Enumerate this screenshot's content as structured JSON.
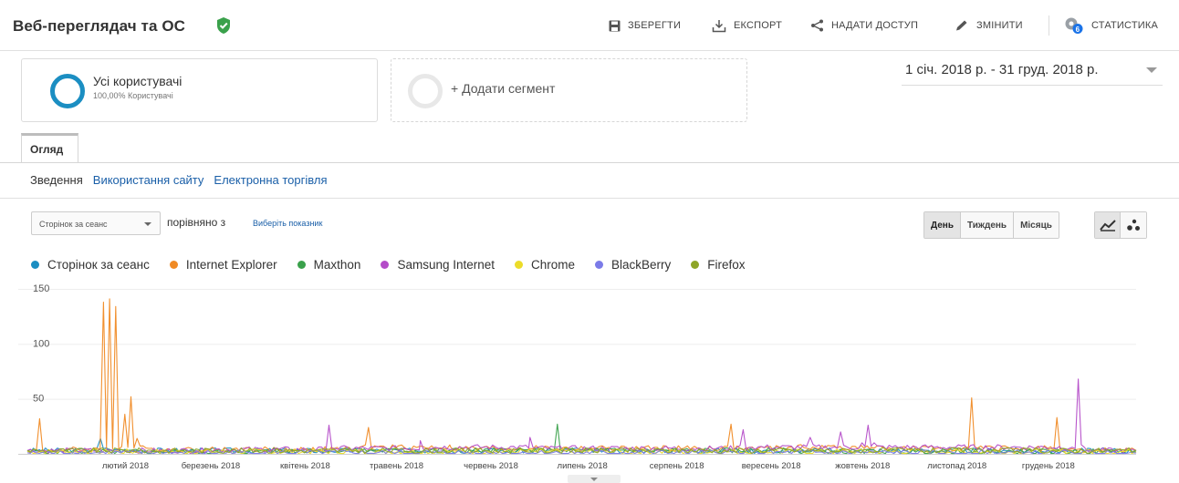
{
  "header": {
    "title": "Веб-переглядач та ОС",
    "actions": {
      "save": "ЗБЕРЕГТИ",
      "export": "ЕКСПОРТ",
      "share": "НАДАТИ ДОСТУП",
      "edit": "ЗМІНИТИ",
      "insights": "СТАТИСТИКА"
    },
    "insights_badge": "6"
  },
  "segments": {
    "active": {
      "name": "Усі користувачі",
      "percent": "100,00% Користувачі"
    },
    "add_label": "+ Додати сегмент"
  },
  "date_range": "1 січ. 2018 р. - 31 груд. 2018 р.",
  "tabs": {
    "overview": "Огляд"
  },
  "subtabs": {
    "summary": "Зведення",
    "site_usage": "Використання сайту",
    "ecommerce": "Електронна торгівля"
  },
  "controls": {
    "metric": "Сторінок за сеанс",
    "compare": "порівняно з",
    "choose_metric": "Виберіть показник",
    "periods": [
      "День",
      "Тиждень",
      "Місяць"
    ],
    "active_period": "День"
  },
  "colors": {
    "accent": "#1b8ec2",
    "verified": "#3aa14b",
    "link": "#1a5fa8"
  },
  "chart_data": {
    "type": "line",
    "title": "",
    "xlabel": "",
    "ylabel": "",
    "ylim": [
      0,
      150
    ],
    "yticks": [
      50,
      100,
      150
    ],
    "grid": true,
    "legend_position": "top-left",
    "xtick_labels": [
      "лютий 2018",
      "березень 2018",
      "квітень 2018",
      "травень 2018",
      "червень 2018",
      "липень 2018",
      "серпень 2018",
      "вересень 2018",
      "жовтень 2018",
      "листопад 2018",
      "грудень 2018"
    ],
    "series": [
      {
        "name": "Сторінок за сеанс",
        "color": "#1b8ec2",
        "x": [
          "2018-01-01",
          "2018-01-20",
          "2018-01-25",
          "2018-01-30",
          "2018-02-15",
          "2018-04-01",
          "2018-06-01",
          "2018-08-01",
          "2018-10-01",
          "2018-12-31"
        ],
        "values": [
          3,
          4,
          14,
          4,
          3,
          3,
          3,
          3,
          3,
          3
        ]
      },
      {
        "name": "Internet Explorer",
        "color": "#f08a24",
        "x": [
          "2018-01-01",
          "2018-01-05",
          "2018-01-09",
          "2018-01-15",
          "2018-01-26",
          "2018-01-28",
          "2018-01-30",
          "2018-02-02",
          "2018-02-04",
          "2018-02-06",
          "2018-02-10",
          "2018-03-15",
          "2018-04-20",
          "2018-04-23",
          "2018-05-20",
          "2018-06-15",
          "2018-07-10",
          "2018-08-07",
          "2018-08-20",
          "2018-08-23",
          "2018-09-05",
          "2018-10-05",
          "2018-11-04",
          "2018-11-07",
          "2018-11-20",
          "2018-12-02",
          "2018-12-05",
          "2018-12-31"
        ],
        "values": [
          3,
          32,
          3,
          4,
          138,
          141,
          134,
          36,
          52,
          14,
          5,
          4,
          6,
          24,
          6,
          5,
          5,
          5,
          27,
          5,
          6,
          6,
          5,
          51,
          5,
          5,
          33,
          3
        ]
      },
      {
        "name": "Maxthon",
        "color": "#3aa14b",
        "x": [
          "2018-01-01",
          "2018-03-15",
          "2018-06-22",
          "2018-06-24",
          "2018-06-26",
          "2018-09-10",
          "2018-12-31"
        ],
        "values": [
          2,
          3,
          4,
          27,
          4,
          3,
          2
        ]
      },
      {
        "name": "Samsung Internet",
        "color": "#b44cc8",
        "x": [
          "2018-01-01",
          "2018-03-01",
          "2018-04-08",
          "2018-04-10",
          "2018-04-12",
          "2018-05-10",
          "2018-06-15",
          "2018-08-10",
          "2018-08-22",
          "2018-08-24",
          "2018-08-26",
          "2018-09-15",
          "2018-09-25",
          "2018-10-02",
          "2018-10-04",
          "2018-10-06",
          "2018-11-20",
          "2018-12-10",
          "2018-12-12",
          "2018-12-14",
          "2018-12-31"
        ],
        "values": [
          3,
          4,
          5,
          26,
          5,
          12,
          15,
          5,
          6,
          22,
          6,
          15,
          20,
          10,
          26,
          10,
          6,
          6,
          68,
          6,
          3
        ]
      },
      {
        "name": "Chrome",
        "color": "#ecdc29",
        "x": [
          "2018-01-01",
          "2018-06-01",
          "2018-12-31"
        ],
        "values": [
          2,
          2,
          2
        ]
      },
      {
        "name": "BlackBerry",
        "color": "#7b7be8",
        "x": [
          "2018-01-01",
          "2018-06-01",
          "2018-12-31"
        ],
        "values": [
          1,
          1,
          1
        ]
      },
      {
        "name": "Firefox",
        "color": "#8ea528",
        "x": [
          "2018-01-01",
          "2018-05-01",
          "2018-09-01",
          "2018-12-31"
        ],
        "values": [
          3,
          4,
          3,
          3
        ]
      }
    ]
  }
}
